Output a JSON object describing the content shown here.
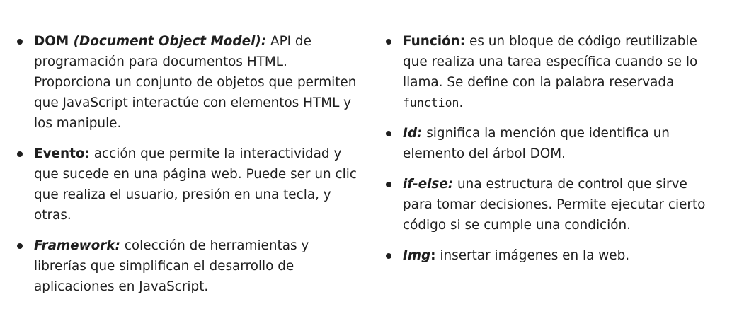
{
  "left_column": [
    {
      "term": "DOM",
      "term_extra": " (Document Object Model):",
      "definition": " API de programación para documentos HTML. Proporciona un conjunto de objetos que permiten que JavaScript interactúe con elementos HTML y los manipule."
    },
    {
      "term": "Evento:",
      "definition": " acción que permite la interactividad y que sucede en una página web. Puede ser un clic que realiza el usuario, presión en una tecla, y otras."
    },
    {
      "term": "Framework:",
      "definition": " colección de herramientas y librerías que simplifican el desarrollo de aplicaciones en JavaScript."
    }
  ],
  "right_column": [
    {
      "term": "Función:",
      "definition": " es un bloque de código reutilizable que realiza una tarea específica cuando se lo llama. Se define con la palabra reservada ",
      "code": "function",
      "definition_end": "."
    },
    {
      "term": "Id:",
      "definition": " significa la mención que identifica un elemento del árbol DOM."
    },
    {
      "term": "if-else:",
      "definition": " una estructura de control que sirve para tomar decisiones. Permite ejecutar cierto código si se cumple una condición."
    },
    {
      "term": "Img",
      "term_extra": ":",
      "definition": " insertar imágenes en la web."
    }
  ]
}
